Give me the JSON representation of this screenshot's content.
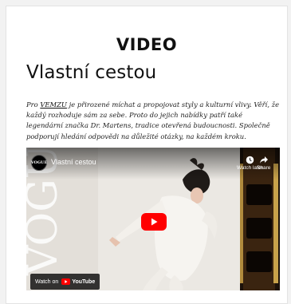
{
  "section": {
    "heading": "VIDEO"
  },
  "article": {
    "title": "Vlastní cestou",
    "intro_before_link": "Pro ",
    "intro_link": "VEMZU",
    "intro_after_link": " je přirozené míchat a propojovat styly a kulturní vlivy. Věří, že každý rozhoduje sám za sebe. Proto do jejich nabídky patří také legendární značka Dr. Martens, tradice otevřená budoucnosti. Společně podporují hledání odpovědi na důležité otázky, na každém kroku."
  },
  "video": {
    "channel_avatar_text": "VOGUE",
    "title": "Vlastní cestou",
    "watch_later_label": "Watch later",
    "share_label": "Share",
    "watch_on_label": "Watch on",
    "youtube_label": "YouTube",
    "thumbnail_overlay_text": "VOGUE",
    "icons": {
      "play": "play-icon",
      "clock": "clock-icon",
      "share": "share-icon",
      "youtube": "youtube-logo-icon"
    },
    "colors": {
      "play_button": "#ff0000"
    }
  }
}
